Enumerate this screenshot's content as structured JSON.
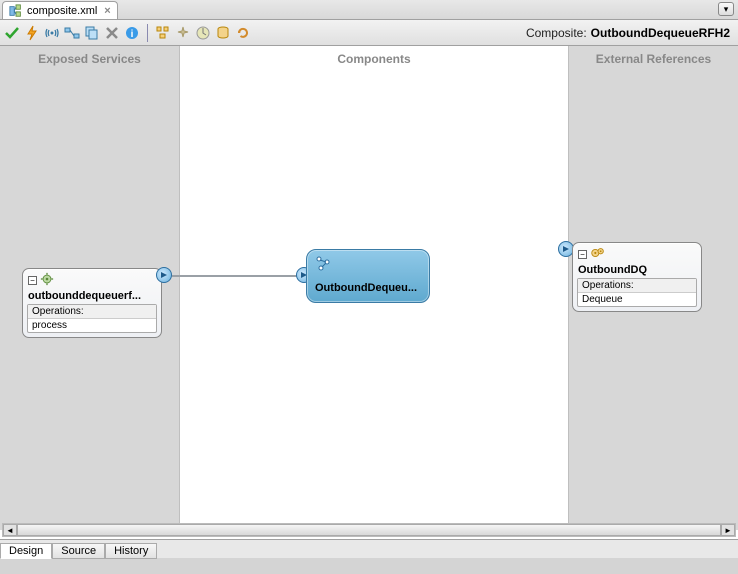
{
  "tab": {
    "label": "composite.xml"
  },
  "compositeLabel": "Composite:",
  "compositeName": "OutboundDequeueRFH2",
  "lanes": {
    "left": "Exposed Services",
    "center": "Components",
    "right": "External References"
  },
  "service": {
    "title": "outbounddequeuerf...",
    "sectionHeader": "Operations:",
    "operation": "process"
  },
  "component": {
    "label": "OutboundDequeu..."
  },
  "reference": {
    "title": "OutboundDQ",
    "sectionHeader": "Operations:",
    "operation": "Dequeue"
  },
  "bottomTabs": [
    "Design",
    "Source",
    "History"
  ]
}
